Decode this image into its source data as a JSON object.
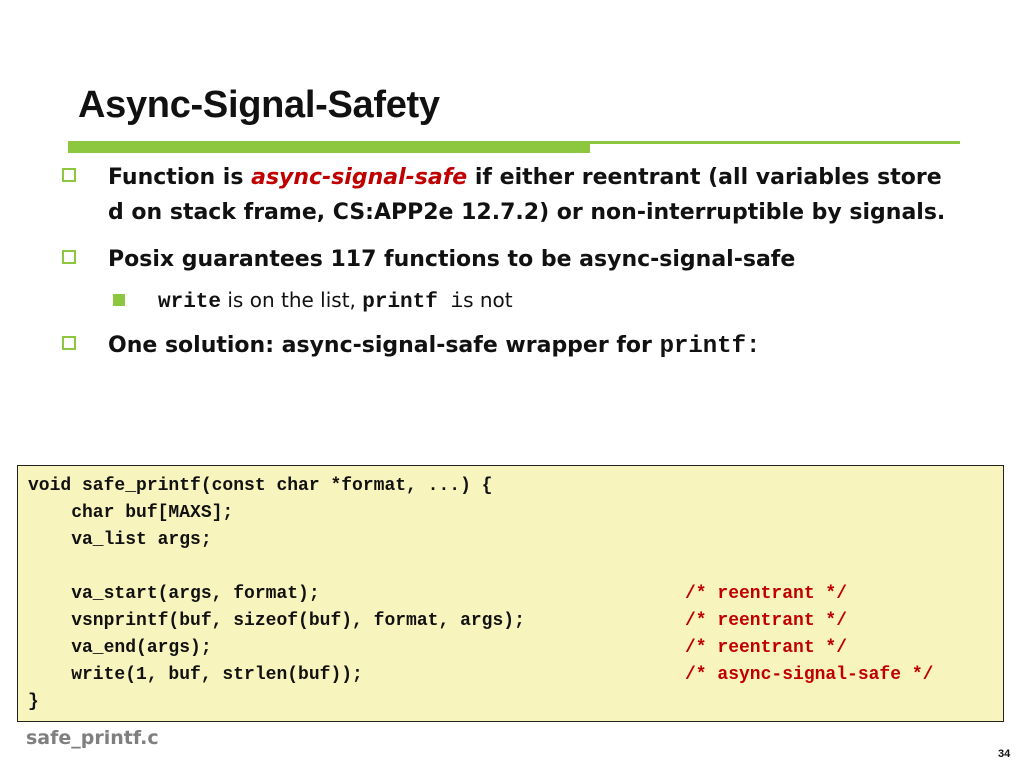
{
  "slide": {
    "title": "Async-Signal-Safety",
    "bullet1": {
      "prefix": "Function is ",
      "emphasis": "async-signal-safe",
      "line1_suffix": " if either reentrant (all variables store",
      "line2": "d on stack frame, CS:APP2e 12.7.2) or non-interruptible by signals."
    },
    "bullet2": "Posix guarantees 117 functions to be async-signal-safe",
    "sub_bullet": {
      "code1": "write",
      "text1": " is on the list, ",
      "code2": "printf",
      "code3": " i",
      "text2": "s not"
    },
    "bullet3": {
      "text": "One solution: async-signal-safe wrapper for ",
      "code": "printf",
      "suffix": ":"
    },
    "code_lines": [
      "void safe_printf(const char *format, ...) {",
      "    char buf[MAXS];",
      "    va_list args;",
      "",
      "    va_start(args, format);",
      "    vsnprintf(buf, sizeof(buf), format, args);",
      "    va_end(args);",
      "    write(1, buf, strlen(buf));",
      "}"
    ],
    "code_comments": {
      "c4": "/* reentrant */",
      "c5": "/* reentrant */",
      "c6": "/* reentrant */",
      "c7": "/* async-signal-safe */"
    },
    "filename": "safe_printf.c",
    "page_number": "34"
  },
  "colors": {
    "accent_green": "#8dc63f",
    "emphasis_red": "#c00000",
    "code_background": "#f8f4be",
    "filename_gray": "#7f7f7f"
  }
}
